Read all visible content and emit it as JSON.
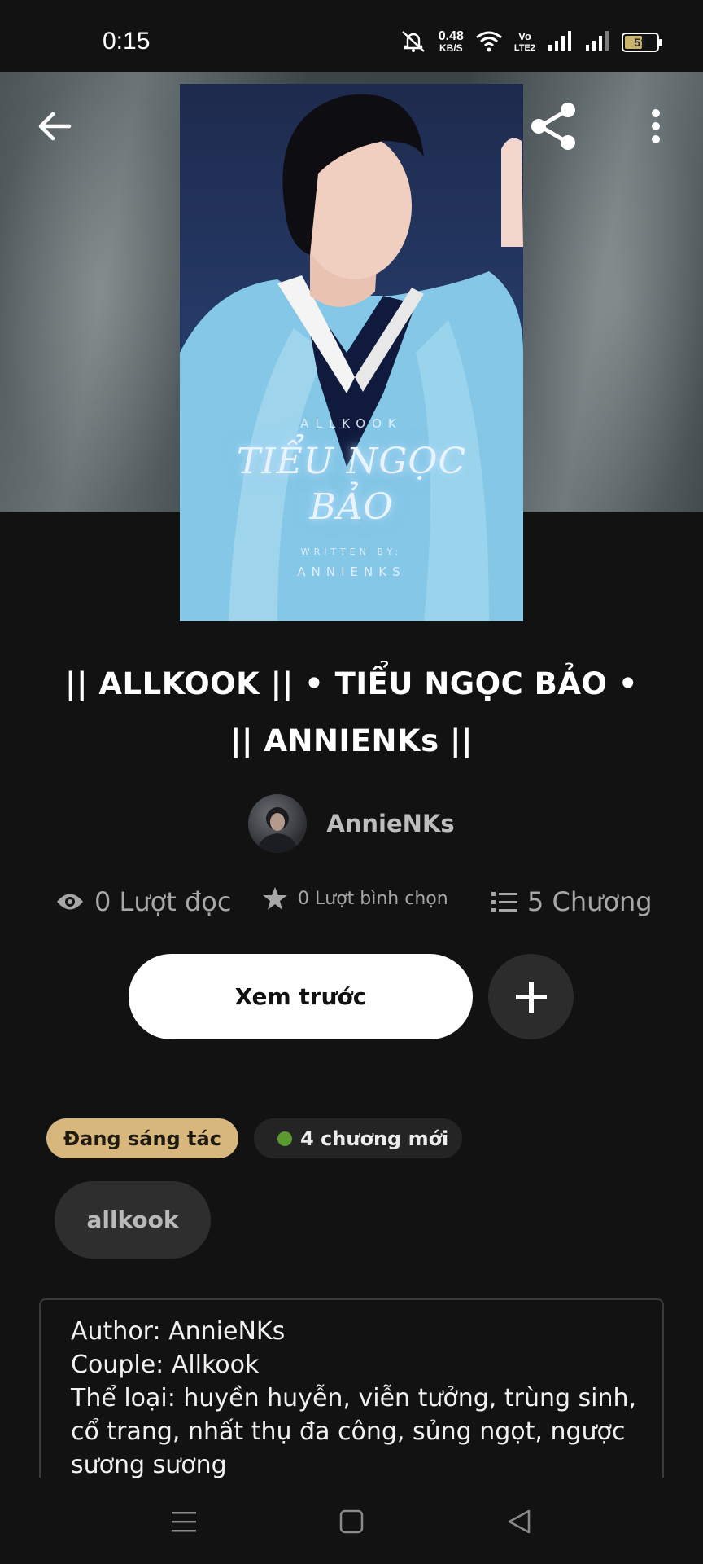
{
  "status_bar": {
    "time": "0:15",
    "net_speed_value": "0.48",
    "net_speed_unit": "KB/S",
    "volte_top": "Vo",
    "volte_bottom": "LTE2",
    "battery_level": "51"
  },
  "icons": {
    "back": "back-arrow-icon",
    "share": "share-icon",
    "more": "more-vertical-icon",
    "reads": "eye-icon",
    "votes": "star-icon",
    "parts": "list-icon",
    "add": "plus-icon"
  },
  "cover": {
    "series": "ALLKOOK",
    "title_line1": "TIỂU NGỌC",
    "title_line2": "BẢO",
    "written_by": "WRITTEN BY:",
    "author": "ANNIENKS"
  },
  "story": {
    "title": "|| ALLKOOK || • TIỂU NGỌC BẢO • || ANNIENKs ||",
    "author": "AnnieNKs"
  },
  "stats": {
    "reads": "0 Lượt đọc",
    "votes": "0 Lượt bình chọn",
    "parts": "5 Chương"
  },
  "actions": {
    "preview_label": "Xem trước"
  },
  "badges": {
    "status": "Đang sáng tác",
    "new_parts": "4 chương mới"
  },
  "tags": [
    "allkook"
  ],
  "description": {
    "lines": [
      "Author: AnnieNKs",
      "Couple: Allkook",
      "Thể loại: huyền huyễn, viễn tưởng, trùng sinh, cổ trang, nhất thụ đa công, sủng ngọt, ngược sương sương"
    ]
  },
  "colors": {
    "background": "#121212",
    "status_badge": "#d7b77c",
    "new_dot": "#5b9a2f",
    "button_primary": "#ffffff",
    "button_secondary": "#2c2c2c"
  }
}
